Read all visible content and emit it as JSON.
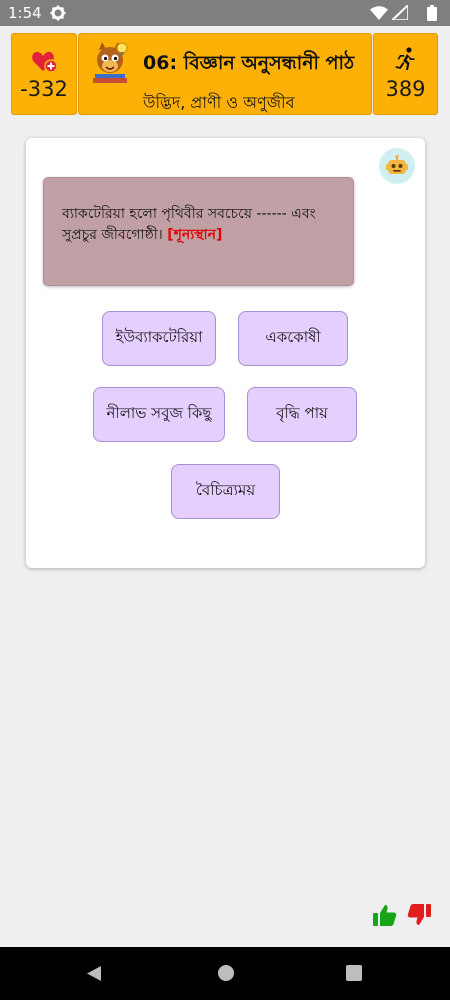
{
  "status_bar": {
    "time": "1:54",
    "icons": [
      "gear-icon",
      "wifi-icon",
      "signal-icon",
      "battery-icon"
    ]
  },
  "header": {
    "lives": "-332",
    "title": "06: বিজ্ঞান অনুসন্ধানী পাঠ",
    "subtitle": "উদ্ভিদ, প্রাণী ও অণুজীব",
    "steps": "389",
    "accent_color": "#fdb106"
  },
  "question": {
    "text": "ব্যাকটেরিয়া হলো পৃথিবীর সবচেয়ে ------ এবং সুপ্রচুর জীবগোষ্ঠী।",
    "blank_marker": "[শূন্যস্থান]"
  },
  "options": [
    {
      "label": "ইউব্যাকটেরিয়া"
    },
    {
      "label": "এককোষী"
    },
    {
      "label": "নীলাভ সবুজ কিছু"
    },
    {
      "label": "বৃদ্ধি পায়"
    },
    {
      "label": "বৈচিত্র্যময়"
    }
  ],
  "feedback": {
    "like_icon": "thumbs-up-icon",
    "dislike_icon": "thumbs-down-icon",
    "like_color": "#17a417",
    "dislike_color": "#e21d1d"
  }
}
